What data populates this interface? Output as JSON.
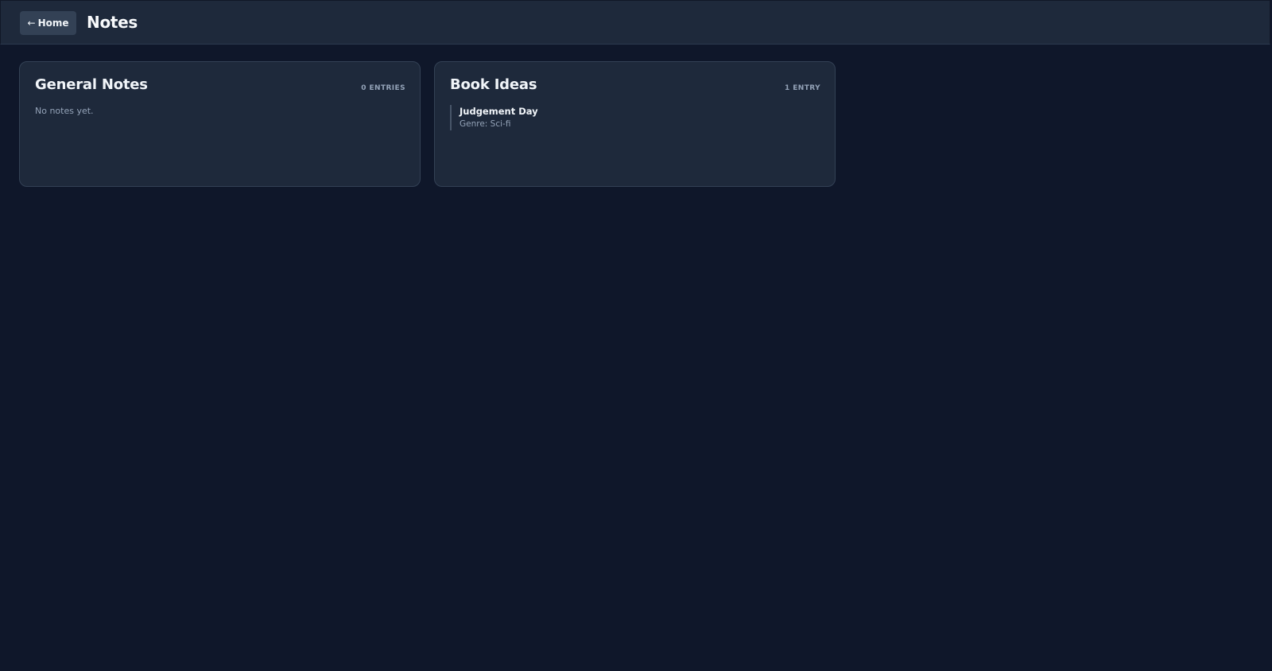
{
  "header": {
    "home_button": {
      "arrow": "←",
      "label": "Home"
    },
    "title": "Notes"
  },
  "cards": [
    {
      "title": "General Notes",
      "count": "0 ENTRIES",
      "empty_message": "No notes yet."
    },
    {
      "title": "Book Ideas",
      "count": "1 ENTRY",
      "entries": [
        {
          "title": "Judgement Day",
          "meta": "Genre: Sci-fi"
        }
      ]
    }
  ],
  "colors": {
    "background": "#0f172a",
    "surface": "#1e293b",
    "border": "#334155",
    "muted_text": "#94a3b8",
    "primary_text": "#f1f5f9"
  }
}
